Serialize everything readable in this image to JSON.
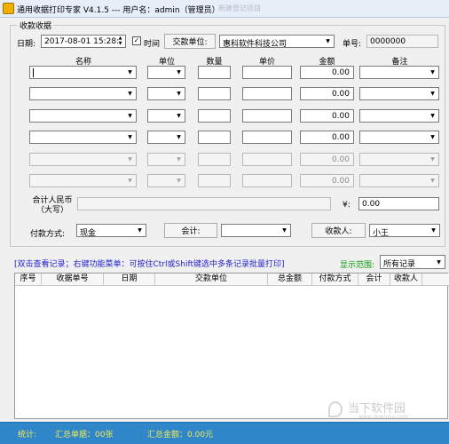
{
  "window": {
    "title": "通用收据打印专家 V4.1.5 --- 用户名：admin（管理员）",
    "title_ghost": "新建登记项目"
  },
  "form": {
    "group_title": "收款收据",
    "date_label": "日期:",
    "date_value": "2017-08-01 15:28:",
    "time_checkbox_label": "时间",
    "time_checked": "✓",
    "payer_button": "交款单位:",
    "payer_value": "惠科软件科技公司",
    "receipt_no_label": "单号:",
    "receipt_no_value": "0000000",
    "columns": [
      "名称",
      "单位",
      "数量",
      "单价",
      "金额",
      "备注"
    ],
    "rows": [
      {
        "amount": "0.00"
      },
      {
        "amount": "0.00"
      },
      {
        "amount": "0.00"
      },
      {
        "amount": "0.00"
      },
      {
        "amount": "0.00"
      },
      {
        "amount": "0.00"
      }
    ],
    "total_rmb_label": "合计人民币\n（大写）",
    "total_rmb_line1": "合计人民币",
    "total_rmb_line2": "（大写）",
    "yen_label": "¥:",
    "yen_value": "0.00",
    "pay_method_label": "付款方式:",
    "pay_method_value": "现金",
    "total_button": "会计:",
    "total_value": "",
    "payee_button": "收款人:",
    "payee_value": "小王"
  },
  "hint": "[双击查看记录；右键功能菜单：可按住Ctrl或Shift键选中多条记录批量打印]",
  "range": {
    "label": "显示范围:",
    "value": "所有记录"
  },
  "grid": {
    "columns": [
      "序号",
      "收据单号",
      "日期",
      "交款单位",
      "总金额",
      "付款方式",
      "会计",
      "收款人"
    ]
  },
  "status": {
    "stat_label": "统计:",
    "total_count": "汇总单据：00张",
    "total_amount": "汇总金额：0.00元"
  },
  "watermark": {
    "text": "当下软件园",
    "sub": "www.downxia.com"
  },
  "colors": {
    "status_bar": "#2f86c8",
    "status_text": "#f4e95a",
    "hint": "#2020d0",
    "range_label": "#0a9a0a"
  }
}
